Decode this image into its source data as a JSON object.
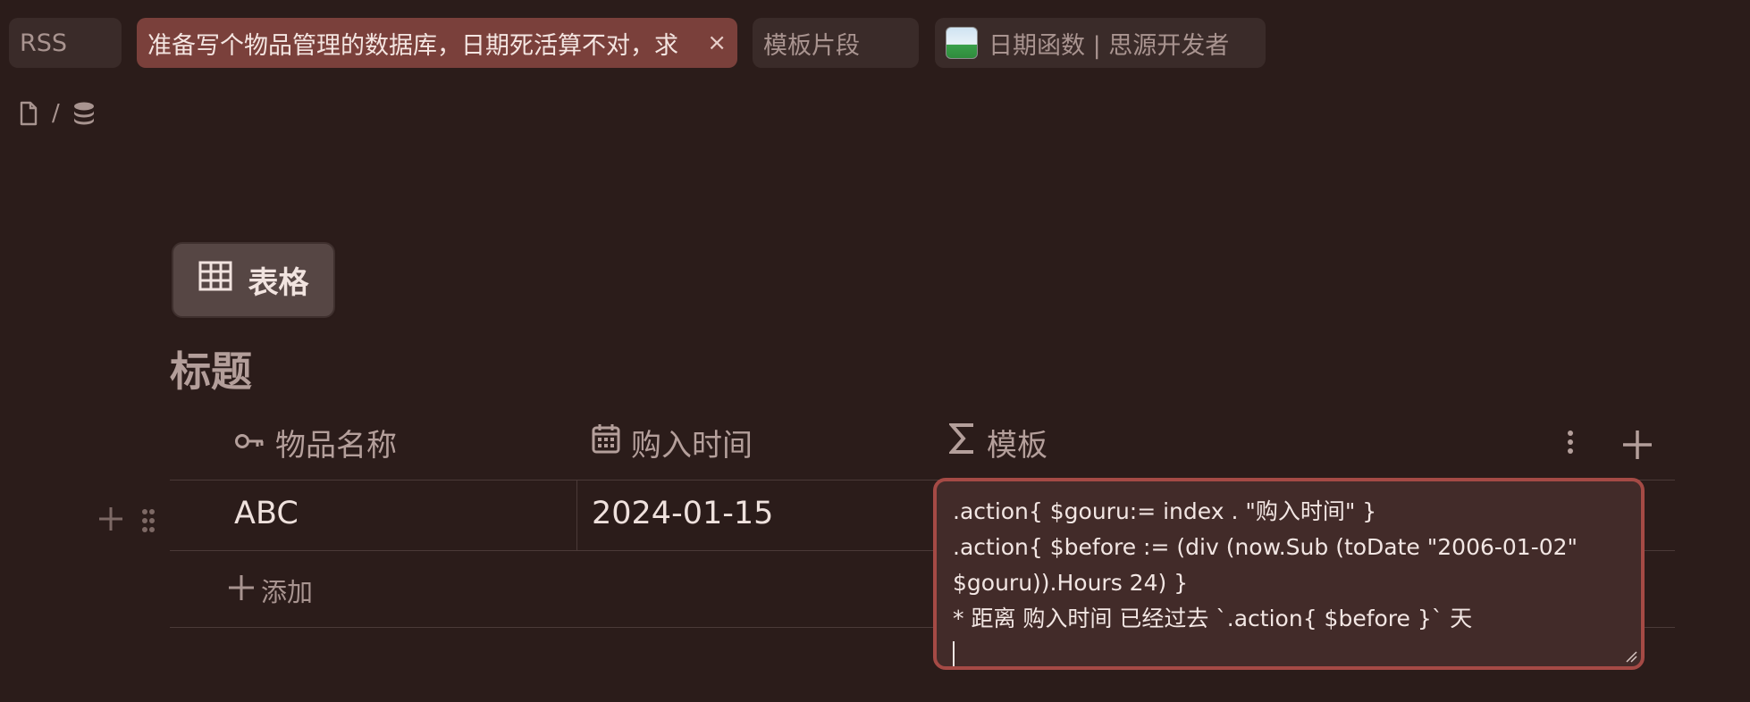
{
  "tabs": [
    {
      "label": "RSS",
      "active": false
    },
    {
      "label": "准备写个物品管理的数据库，日期死活算不对，求",
      "active": true,
      "close": "×"
    },
    {
      "label": "模板片段",
      "active": false
    },
    {
      "label": "日期函数 | 思源开发者",
      "active": false,
      "icon": "image-favicon-icon"
    }
  ],
  "breadcrumb": {
    "separator": "/",
    "items": [
      "document-icon",
      "database-icon"
    ]
  },
  "view": {
    "label": "表格",
    "icon": "table-grid-icon"
  },
  "database": {
    "title": "标题"
  },
  "columns": [
    {
      "label": "物品名称",
      "icon": "key-icon"
    },
    {
      "label": "购入时间",
      "icon": "calendar-icon"
    },
    {
      "label": "模板",
      "icon": "sigma-icon"
    }
  ],
  "rows": [
    {
      "name": "ABC",
      "date": "2024-01-15"
    }
  ],
  "add_row": {
    "label": "添加",
    "icon": "plus-icon"
  },
  "editor": {
    "lines": [
      ".action{ $gouru:= index . \"购入时间\" }",
      ".action{ $before := (div (now.Sub (toDate \"2006-01-02\"",
      "$gouru)).Hours 24) }",
      "* 距离 购入时间 已经过去 `.action{ $before }` 天"
    ]
  },
  "colors": {
    "background": "#2b1c1a",
    "active_tab": "#7a403b",
    "editor_border": "#a54a45"
  }
}
